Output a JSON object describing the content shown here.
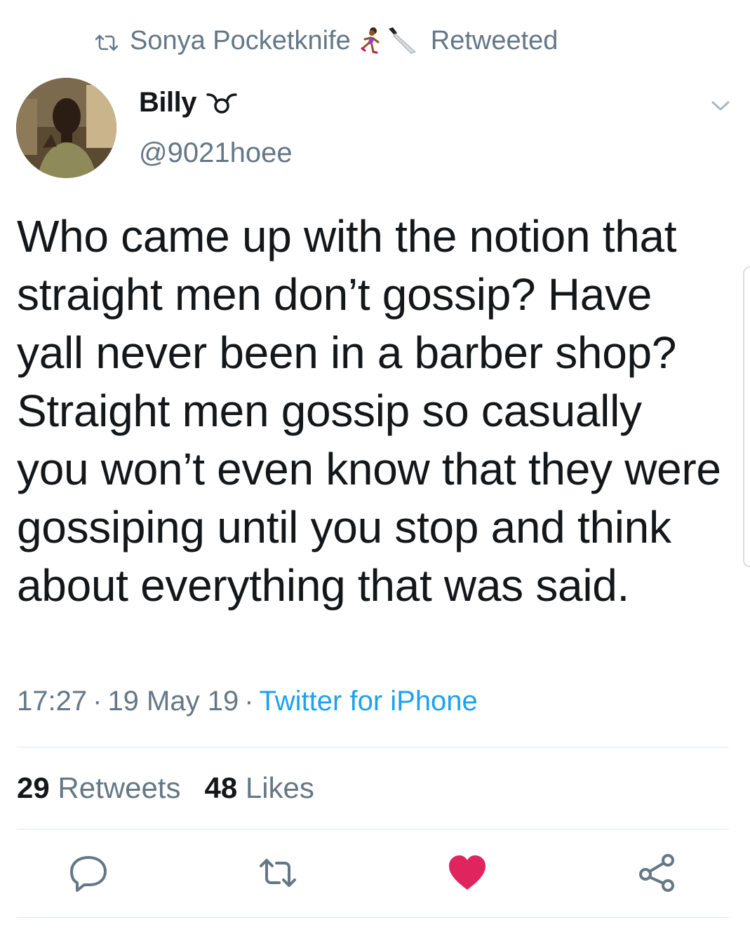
{
  "retweet_context": {
    "user": "Sonya Pocketknife",
    "label": "Retweeted",
    "icon": "retweet-icon",
    "emojis": [
      "woman-running-emoji",
      "kitchen-knife-emoji"
    ]
  },
  "author": {
    "display_name": "Billy",
    "name_symbol": "♉",
    "handle": "@9021hoee",
    "avatar": "profile-photo"
  },
  "tweet": {
    "text": "Who came up with the notion that straight men don’t gossip? Have yall never been in a barber shop? Straight men gossip so casually you won’t even know that they were gossiping until you stop and think about everything that was said."
  },
  "meta": {
    "time": "17:27",
    "date": "19 May 19",
    "separator": "·",
    "source": "Twitter for iPhone"
  },
  "stats": {
    "retweets_count": "29",
    "retweets_label": "Retweets",
    "likes_count": "48",
    "likes_label": "Likes"
  },
  "actions": {
    "icons": [
      "reply-icon",
      "retweet-icon",
      "like-icon",
      "share-icon"
    ],
    "liked": true
  },
  "colors": {
    "text": "#14171a",
    "secondary": "#657786",
    "link": "#1da1f2",
    "like": "#e0245e",
    "divider": "#e1e8ed"
  }
}
